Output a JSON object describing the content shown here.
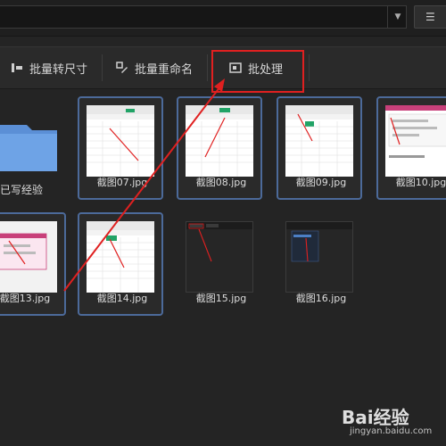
{
  "toolbar": {
    "batch_resize_label": "批量转尺寸",
    "batch_rename_label": "批量重命名",
    "batch_process_label": "批处理"
  },
  "folder": {
    "label": "已写经验"
  },
  "files": [
    {
      "name": "截图07.jpg"
    },
    {
      "name": "截图08.jpg"
    },
    {
      "name": "截图09.jpg"
    },
    {
      "name": "截图10.jpg"
    },
    {
      "name": "截图13.jpg"
    },
    {
      "name": "截图14.jpg"
    },
    {
      "name": "截图15.jpg"
    },
    {
      "name": "截图16.jpg"
    }
  ],
  "watermark": {
    "brand": "Bai经验",
    "url": "jingyan.baidu.com"
  },
  "colors": {
    "annotation": "#e02020",
    "selection_border": "#4c6a9a",
    "background": "#242424"
  }
}
